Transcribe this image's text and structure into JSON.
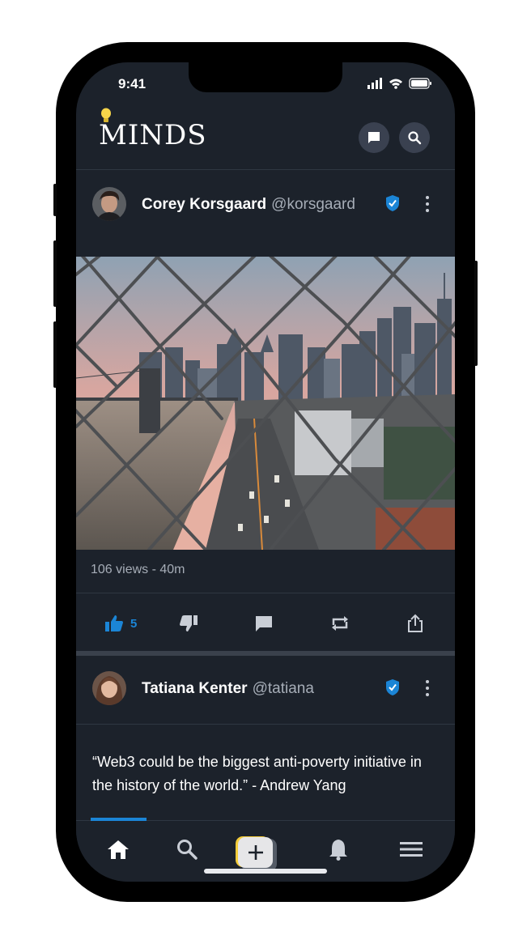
{
  "status": {
    "time": "9:41"
  },
  "header": {
    "logo": "MINDS"
  },
  "posts": [
    {
      "author": "Corey Korsgaard",
      "handle": "@korsgaard",
      "views": "106 views - 40m",
      "likes": "5"
    },
    {
      "author": "Tatiana Kenter",
      "handle": "@tatiana",
      "text": "“Web3 could be the biggest anti-poverty initiative in the history of the world.” - Andrew Yang"
    }
  ],
  "colors": {
    "accent": "#1b85d6",
    "background": "#1c222b",
    "compose": "#f4cd3a"
  },
  "icons": [
    "chat-icon",
    "search-icon",
    "verified-icon",
    "more-icon",
    "thumbs-up-icon",
    "thumbs-down-icon",
    "comment-icon",
    "remind-icon",
    "share-icon",
    "home-icon",
    "plus-icon",
    "bell-icon",
    "menu-icon"
  ]
}
